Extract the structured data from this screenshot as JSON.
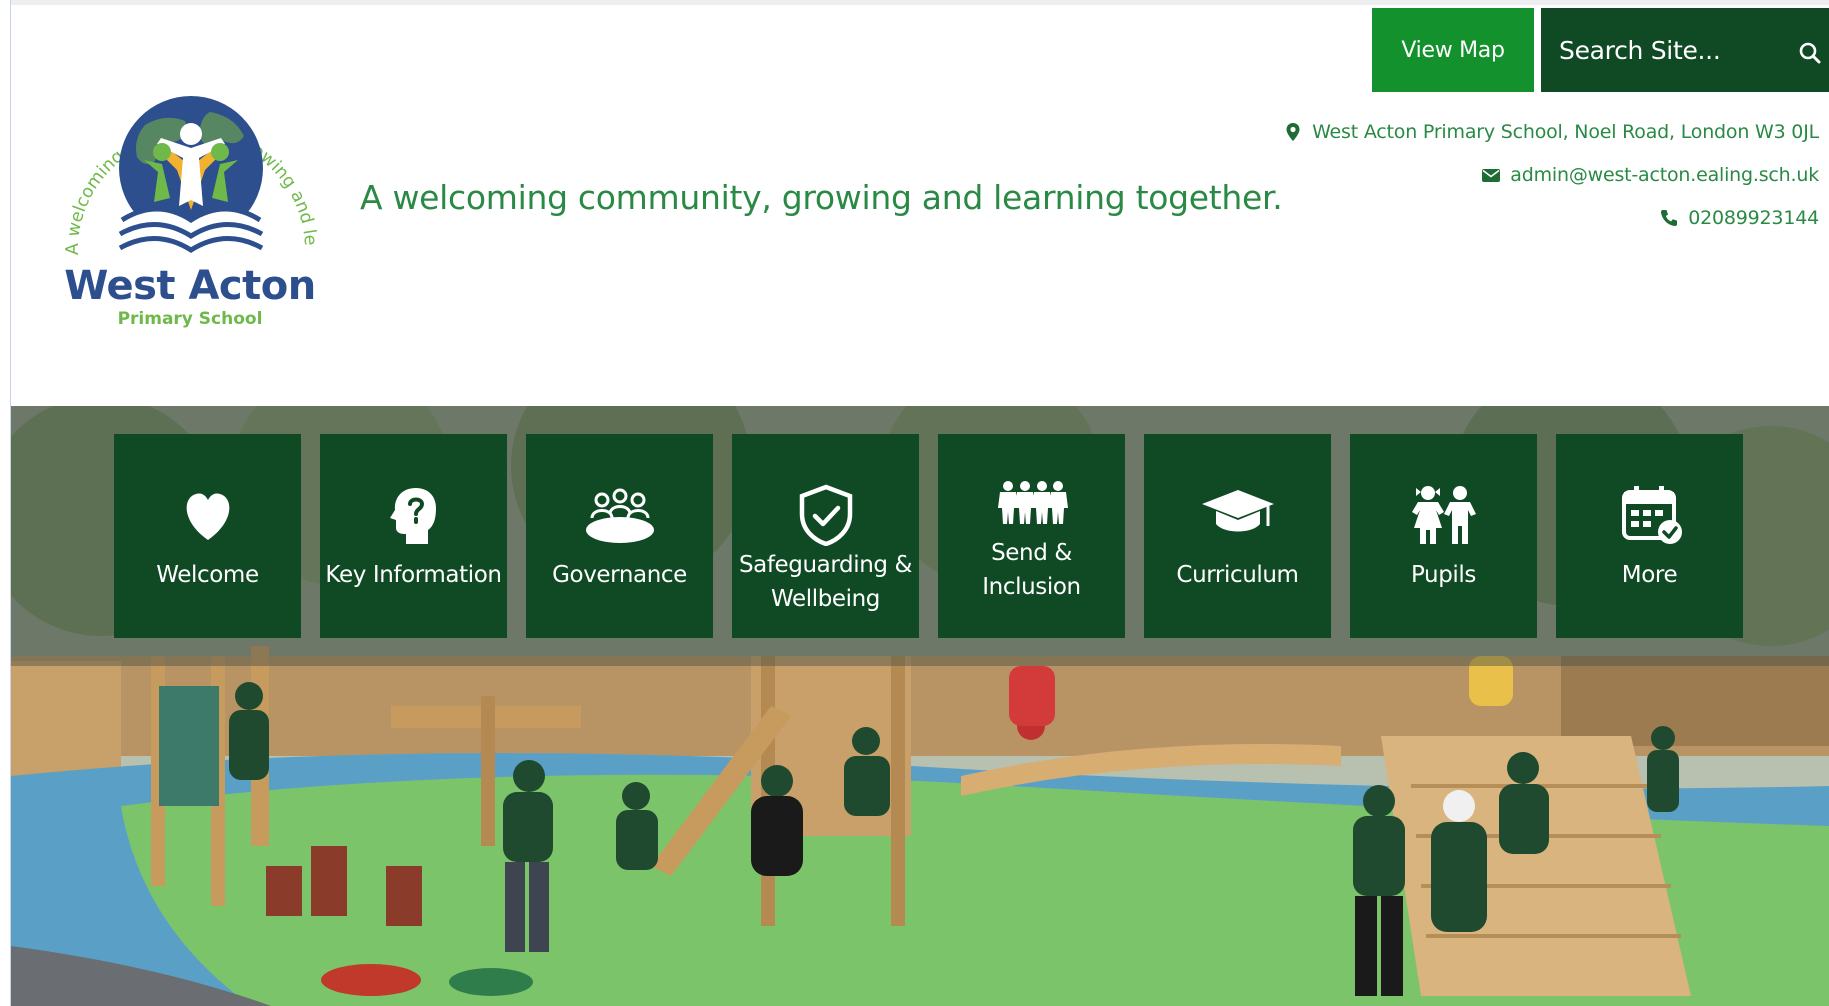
{
  "school": {
    "logo_name": "West Acton",
    "logo_subtitle": "Primary School",
    "logo_ring_text": "A welcoming community, growing and learning together.",
    "tagline": "A welcoming community, growing and learning together."
  },
  "header": {
    "view_map_label": "View Map",
    "search_placeholder": "Search Site...",
    "address": "West Acton Primary School, Noel Road, London W3 0JL",
    "email": "admin@west-acton.ealing.sch.uk",
    "phone": "02089923144",
    "address_icon": "map-marker-icon",
    "email_icon": "envelope-icon",
    "phone_icon": "phone-icon"
  },
  "nav": {
    "tiles": [
      {
        "label": "Welcome",
        "icon": "heart-icon"
      },
      {
        "label": "Key Information",
        "icon": "question-head-icon"
      },
      {
        "label": "Governance",
        "icon": "people-table-icon"
      },
      {
        "label": "Safeguarding & Wellbeing",
        "icon": "shield-check-icon"
      },
      {
        "label": "Send & Inclusion",
        "icon": "paper-people-icon"
      },
      {
        "label": "Curriculum",
        "icon": "graduation-cap-icon"
      },
      {
        "label": "Pupils",
        "icon": "children-icon"
      },
      {
        "label": "More",
        "icon": "calendar-check-icon"
      }
    ]
  },
  "colors": {
    "dark_green": "#0f4a24",
    "bright_green": "#13912c",
    "text_green": "#2a8a45",
    "logo_blue": "#2d4f8e",
    "logo_light_green": "#6fb94a"
  }
}
